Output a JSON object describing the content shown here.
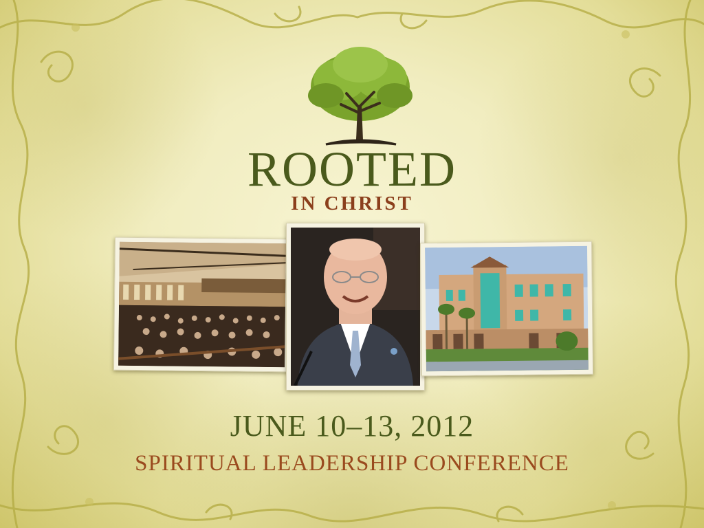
{
  "logo": {
    "title": "ROOTED",
    "subtitle": "IN CHRIST",
    "icon": "tree-icon"
  },
  "event": {
    "dates": "JUNE 10–13, 2012",
    "name": "SPIRITUAL LEADERSHIP CONFERENCE"
  },
  "colors": {
    "title_green": "#4a5a1c",
    "accent_brown": "#8b3f1c",
    "background": "#f1edc0"
  },
  "photos": [
    {
      "subject": "auditorium-crowd"
    },
    {
      "subject": "speaker-portrait"
    },
    {
      "subject": "church-building"
    }
  ]
}
